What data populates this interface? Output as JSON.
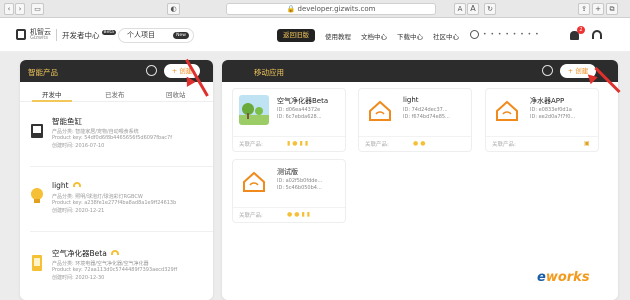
{
  "browser": {
    "url": "developer.gizwits.com",
    "font_small": "A",
    "font_big": "A"
  },
  "header": {
    "logo_main": "机智云",
    "logo_sub": "Gizwits",
    "dev_center": "开发者中心",
    "beta": "Beta",
    "project": "个人项目",
    "project_badge": "New",
    "old_version": "返回旧版",
    "nav": [
      "使用教程",
      "文档中心",
      "下载中心",
      "社区中心"
    ],
    "user_name": "• • • • • • • •",
    "notif_count": "2"
  },
  "left": {
    "title": "智能产品",
    "create": "+ 创建",
    "tabs": [
      "开发中",
      "已发布",
      "回收站"
    ],
    "products": [
      {
        "name": "智能鱼缸",
        "desc": "产品分类: 智能家居/宠物/自动喂食系统",
        "key": "Product key: 54df0d6f8b4465656f5d6097fbac7f",
        "date": "创建时间: 2016-07-10"
      },
      {
        "name": "light",
        "desc": "产品分类: 照明/球泡灯/球泡彩灯RGBCW",
        "key": "Product key: a238fe1e277f4ba8ad8a1e9ff24613b",
        "date": "创建时间: 2020-12-21"
      },
      {
        "name": "空气净化器Beta",
        "desc": "产品分类: 环境电器/空气净化器/空气净化器",
        "key": "Product key: 72aa113d0c5744489f7393aecd329ff",
        "date": "创建时间: 2020-12-30"
      }
    ]
  },
  "right": {
    "title": "移动应用",
    "create": "+ 创建",
    "linked_label": "关联产品:",
    "apps": [
      {
        "name": "空气净化器Beta",
        "id1": "ID: d06ea44372e",
        "id2": "ID: 6c7ebda628..."
      },
      {
        "name": "light",
        "id1": "ID: 74d24dec37...",
        "id2": "ID: f674bd74e85..."
      },
      {
        "name": "净水器APP",
        "id1": "ID: e0833ef0d1a",
        "id2": "ID: ee2d0a7f7f0..."
      },
      {
        "name": "测试版",
        "id1": "ID: a02f5b0fdde...",
        "id2": "ID: 5c46b050b4..."
      }
    ]
  },
  "watermark": {
    "e": "e",
    "rest": "works"
  }
}
